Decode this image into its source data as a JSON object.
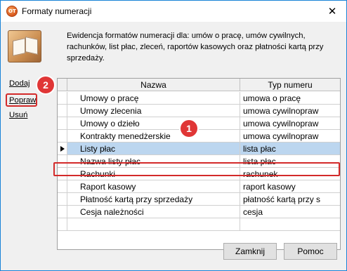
{
  "window": {
    "title": "Formaty numeracji",
    "close_glyph": "✕",
    "app_icon_text": "OT"
  },
  "header": {
    "description": "Ewidencja formatów numeracji dla: umów o pracę, umów cywilnych, rachunków, list płac, zleceń, raportów kasowych oraz płatności kartą przy sprzedaży."
  },
  "sidebar": {
    "add_label": "Dodaj",
    "edit_label": "Popraw",
    "delete_label": "Usuń"
  },
  "annotations": {
    "badge_1": "1",
    "badge_2": "2",
    "highlight_color": "#d32a2a"
  },
  "table": {
    "columns": [
      "Nazwa",
      "Typ numeru"
    ],
    "rows": [
      {
        "name": "Umowy o pracę",
        "type": "umowa o pracę"
      },
      {
        "name": "Umowy zlecenia",
        "type": "umowa cywilnopraw"
      },
      {
        "name": "Umowy o dzieło",
        "type": "umowa cywilnopraw"
      },
      {
        "name": "Kontrakty menedżerskie",
        "type": "umowa cywilnopraw"
      },
      {
        "name": "Listy płac",
        "type": "lista płac",
        "selected": true
      },
      {
        "name": "Nazwa listy płac",
        "type": "lista płac"
      },
      {
        "name": "Rachunki",
        "type": "rachunek"
      },
      {
        "name": "Raport kasowy",
        "type": "raport kasowy"
      },
      {
        "name": "Płatność kartą przy sprzedaży",
        "type": "płatność kartą przy s"
      },
      {
        "name": "Cesja należności",
        "type": "cesja"
      },
      {
        "name": "",
        "type": ""
      }
    ],
    "selected_color": "#bcd6ef"
  },
  "footer": {
    "close_label": "Zamknij",
    "help_label": "Pomoc"
  },
  "icons": {
    "app": "app-logo-icon",
    "book": "open-book-icon",
    "close": "close-icon",
    "row_indicator": "row-pointer-icon"
  }
}
